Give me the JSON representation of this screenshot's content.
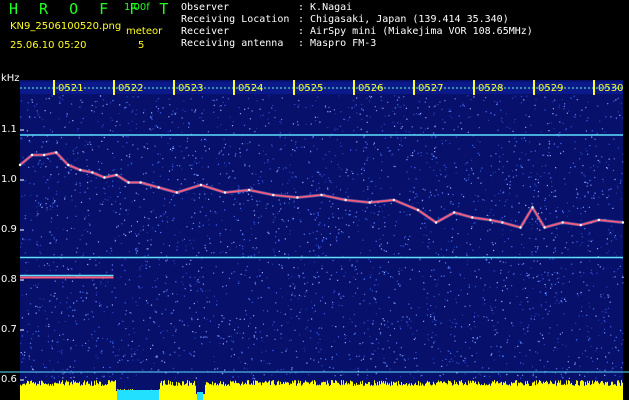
{
  "header": {
    "brand": "H R O F F T",
    "version": "1.00f",
    "filename": "KN9_2506100520.png",
    "meteor_label": "meteor",
    "datetime": "25.06.10 05:20",
    "meteor_count": "5",
    "observer_key": "Observer",
    "observer_val": ": K.Nagai",
    "location_key": "Receiving Location",
    "location_val": ": Chigasaki, Japan (139.414 35.340)",
    "receiver_key": "Receiver",
    "receiver_val": ": AirSpy mini (Miakejima VOR 108.65MHz)",
    "antenna_key": "Receiving antenna",
    "antenna_val": ": Maspro FM-3"
  },
  "colors": {
    "background": "#000000",
    "spectrogram_bg": "#07106a",
    "brand_green": "#22ff22",
    "header_yellow": "#ffff22",
    "signal_trace": "#ff5a78",
    "level_bars": "#ffff00",
    "level_cyan": "#22e0ff",
    "line_cyan": "#5fe0ff"
  },
  "chart_data": {
    "type": "spectrogram",
    "y_unit_label": "kHz",
    "yticks": [
      "1.1",
      "1.0",
      "0.9",
      "0.8",
      "0.7",
      "0.6"
    ],
    "ylim": [
      0.6,
      1.16
    ],
    "time_labels": [
      "0521",
      "0522",
      "0523",
      "0524",
      "0525",
      "0526",
      "0527",
      "0528",
      "0529",
      "0530"
    ],
    "xlim_minutes": [
      0,
      10
    ],
    "horizontal_lines_khz": [
      1.09,
      0.845
    ],
    "main_trace": {
      "x_minutes": [
        0,
        0.2,
        0.4,
        0.6,
        0.8,
        1.0,
        1.2,
        1.4,
        1.6,
        1.8,
        2.0,
        2.3,
        2.6,
        3.0,
        3.4,
        3.8,
        4.2,
        4.6,
        5.0,
        5.4,
        5.8,
        6.2,
        6.6,
        6.9,
        7.2,
        7.5,
        7.8,
        8.0,
        8.3,
        8.5,
        8.7,
        9.0,
        9.3,
        9.6,
        10.0
      ],
      "y_khz": [
        1.03,
        1.05,
        1.05,
        1.055,
        1.03,
        1.02,
        1.015,
        1.005,
        1.01,
        0.995,
        0.995,
        0.985,
        0.975,
        0.99,
        0.975,
        0.98,
        0.97,
        0.965,
        0.97,
        0.96,
        0.955,
        0.96,
        0.94,
        0.915,
        0.935,
        0.925,
        0.92,
        0.915,
        0.905,
        0.945,
        0.905,
        0.915,
        0.91,
        0.92,
        0.915
      ]
    },
    "short_trace": {
      "x_minutes": [
        0,
        1.55
      ],
      "y_khz": [
        0.805,
        0.805
      ]
    }
  }
}
